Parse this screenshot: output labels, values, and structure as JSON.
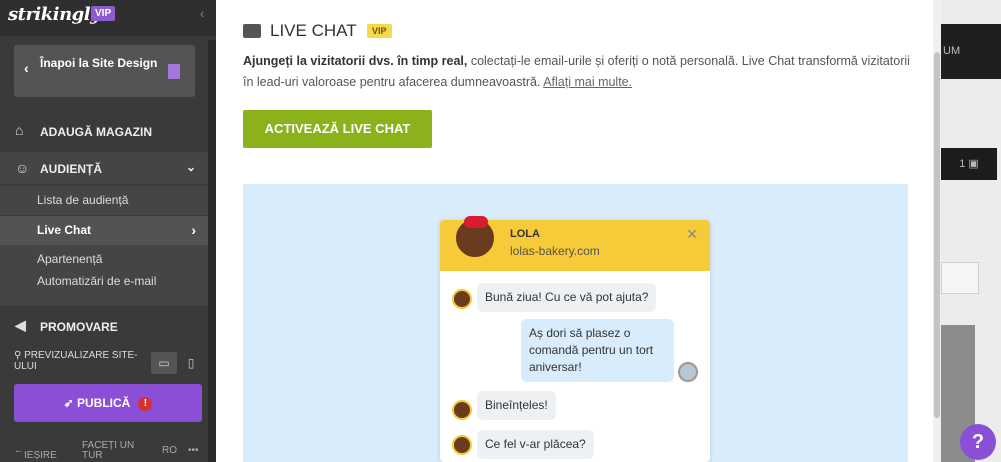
{
  "sidebar": {
    "logo": "strikingly",
    "vip": "VIP",
    "back_label": "Înapoi la Site Design",
    "nav": [
      {
        "label": "ADAUGĂ MAGAZIN",
        "icon": "store-icon"
      },
      {
        "label": "AUDIENȚĂ",
        "icon": "users-icon"
      },
      {
        "label": "PROMOVARE",
        "icon": "megaphone-icon"
      }
    ],
    "audience_items": [
      {
        "label": "Lista de audiență"
      },
      {
        "label": "Live Chat"
      },
      {
        "label": "Apartenență"
      },
      {
        "label": "Automatizări de e-mail"
      }
    ],
    "preview_label": "PREVIZUALIZARE SITE-ULUI",
    "publish_label": "PUBLICĂ",
    "publish_warning": "!",
    "exit_label": "IEȘIRE",
    "tour_label": "FACEȚI UN TUR",
    "lang_label": "RO",
    "more_label": "•••"
  },
  "modal": {
    "title": "LIVE CHAT",
    "vip": "VIP",
    "desc_bold": "Ajungeți la vizitatorii dvs. în timp real,",
    "desc_text": " colectați-le email-urile și oferiți o notă personală. Live Chat transformă vizitatorii în lead-uri valoroase pentru afacerea dumneavoastră. ",
    "desc_link": "Aflați mai multe.",
    "cta": "ACTIVEAZĂ LIVE CHAT"
  },
  "widget": {
    "name": "LOLA",
    "site": "lolas-bakery.com",
    "messages": [
      {
        "from": "agent",
        "text": "Bună ziua! Cu ce vă pot ajuta?"
      },
      {
        "from": "visitor",
        "text": "Aș dori să plasez o comandă pentru un tort aniversar!"
      },
      {
        "from": "agent",
        "text": "Bineînțeles!"
      },
      {
        "from": "agent",
        "text": "Ce fel v-ar plăcea?"
      }
    ]
  },
  "background": {
    "right_text_1": "UM",
    "right_text_2": "1"
  },
  "help_label": "?"
}
